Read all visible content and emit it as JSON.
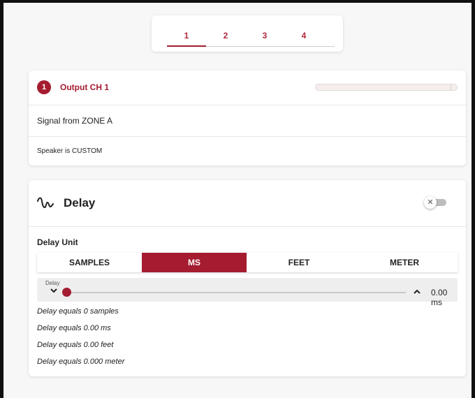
{
  "tabs": {
    "items": [
      {
        "label": "1"
      },
      {
        "label": "2"
      },
      {
        "label": "3"
      },
      {
        "label": "4"
      }
    ],
    "selected": "1"
  },
  "output": {
    "badge": "1",
    "title": "Output CH 1",
    "signal": "Signal from ZONE A",
    "speaker": "Speaker is CUSTOM"
  },
  "delay": {
    "title": "Delay",
    "icon": "waveform-icon",
    "enabled": false,
    "unit_label": "Delay Unit",
    "units": [
      {
        "label": "SAMPLES"
      },
      {
        "label": "MS"
      },
      {
        "label": "FEET"
      },
      {
        "label": "METER"
      }
    ],
    "selected_unit": "MS",
    "slider": {
      "label": "Delay",
      "value": "0.00 ms",
      "position": 0
    },
    "equals": [
      "Delay equals 0 samples",
      "Delay equals 0.00 ms",
      "Delay equals 0.00 feet",
      "Delay equals 0.000 meter"
    ]
  },
  "colors": {
    "accent": "#a51c30",
    "background": "#f7f7f7",
    "card": "#ffffff"
  }
}
